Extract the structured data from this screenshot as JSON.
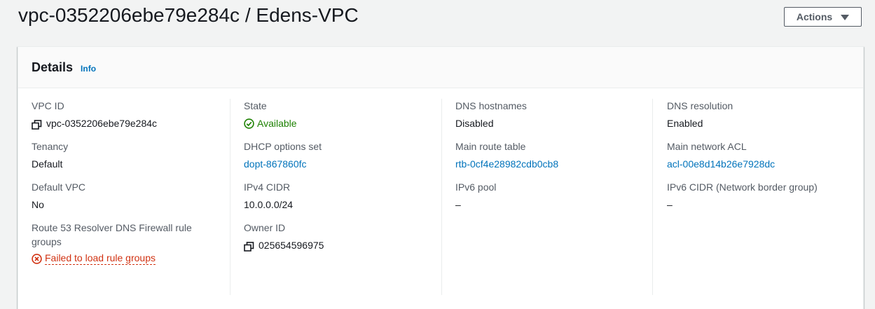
{
  "page": {
    "title": "vpc-0352206ebe79e284c / Edens-VPC",
    "actions_label": "Actions"
  },
  "details": {
    "title": "Details",
    "info_label": "Info",
    "columns": [
      [
        {
          "label": "VPC ID",
          "value": "vpc-0352206ebe79e284c",
          "icon": "copy-icon"
        },
        {
          "label": "Tenancy",
          "value": "Default"
        },
        {
          "label": "Default VPC",
          "value": "No"
        },
        {
          "label": "Route 53 Resolver DNS Firewall rule groups",
          "value": "Failed to load rule groups",
          "icon": "error-circle-x-icon"
        }
      ],
      [
        {
          "label": "State",
          "value": "Available",
          "icon": "success-check-circle-icon"
        },
        {
          "label": "DHCP options set",
          "value": "dopt-867860fc",
          "link": true
        },
        {
          "label": "IPv4 CIDR",
          "value": "10.0.0.0/24"
        },
        {
          "label": "Owner ID",
          "value": "025654596975",
          "icon": "copy-icon"
        }
      ],
      [
        {
          "label": "DNS hostnames",
          "value": "Disabled"
        },
        {
          "label": "Main route table",
          "value": "rtb-0cf4e28982cdb0cb8",
          "link": true
        },
        {
          "label": "IPv6 pool",
          "value": "–"
        }
      ],
      [
        {
          "label": "DNS resolution",
          "value": "Enabled"
        },
        {
          "label": "Main network ACL",
          "value": "acl-00e8d14b26e7928dc",
          "link": true
        },
        {
          "label": "IPv6 CIDR (Network border group)",
          "value": "–"
        }
      ]
    ]
  },
  "colors": {
    "background": "#f2f3f3",
    "link": "#0073bb",
    "success": "#1d8102",
    "error": "#d13212",
    "label": "#545b64",
    "text": "#16191f"
  }
}
